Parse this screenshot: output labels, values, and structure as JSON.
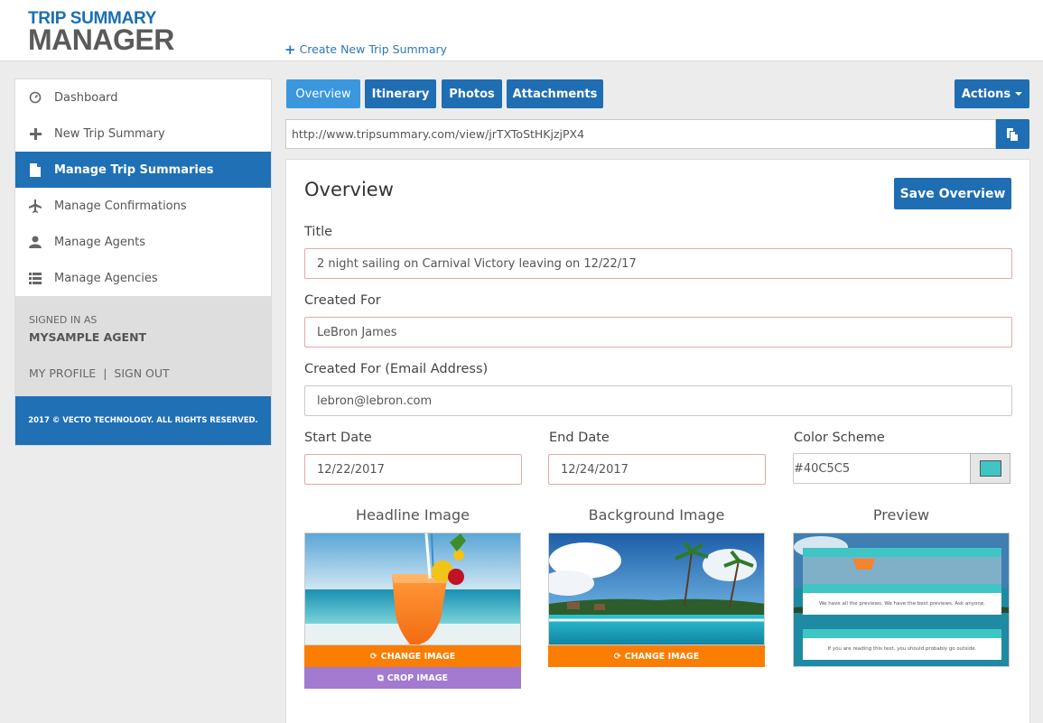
{
  "logo": {
    "line1": "TRIP SUMMARY",
    "line2": "MANAGER"
  },
  "header": {
    "create_link": "Create New Trip Summary"
  },
  "sidebar": {
    "items": [
      {
        "label": "Dashboard",
        "icon": "dashboard-icon"
      },
      {
        "label": "New Trip Summary",
        "icon": "plus-icon"
      },
      {
        "label": "Manage Trip Summaries",
        "icon": "document-icon",
        "active": true
      },
      {
        "label": "Manage Confirmations",
        "icon": "plane-icon"
      },
      {
        "label": "Manage Agents",
        "icon": "user-icon"
      },
      {
        "label": "Manage Agencies",
        "icon": "list-icon"
      }
    ],
    "signed_in_label": "SIGNED IN AS",
    "signed_in_name": "MYSAMPLE AGENT",
    "my_profile": "MY PROFILE",
    "separator": "|",
    "sign_out": "SIGN OUT",
    "copyright": "2017 © VECTO TECHNOLOGY. ALL RIGHTS RESERVED."
  },
  "tabs": [
    "Overview",
    "Itinerary",
    "Photos",
    "Attachments"
  ],
  "actions_label": "Actions",
  "share_url": "http://www.tripsummary.com/view/jrTXToStHKjzjPX4",
  "overview": {
    "heading": "Overview",
    "save_label": "Save Overview",
    "title_label": "Title",
    "title_value": "2 night sailing on Carnival Victory leaving on 12/22/17",
    "created_for_label": "Created For",
    "created_for_value": "LeBron James",
    "email_label": "Created For (Email Address)",
    "email_value": "lebron@lebron.com",
    "start_label": "Start Date",
    "start_value": "12/22/2017",
    "end_label": "End Date",
    "end_value": "12/24/2017",
    "color_label": "Color Scheme",
    "color_value": "#40C5C5"
  },
  "images": {
    "headline_title": "Headline Image",
    "background_title": "Background Image",
    "preview_title": "Preview",
    "change_label": "CHANGE IMAGE",
    "crop_label": "CROP IMAGE",
    "preview_text_1": "We have all the previews. We have the best previews. Ask anyone.",
    "preview_text_2": "If you are reading this text, you should probably go outside."
  },
  "colors": {
    "brand_blue": "#1f6db2",
    "tab_active": "#3a97dd",
    "accent_orange": "#fb7d02",
    "accent_purple": "#a27bd0",
    "scheme": "#40C5C5"
  }
}
